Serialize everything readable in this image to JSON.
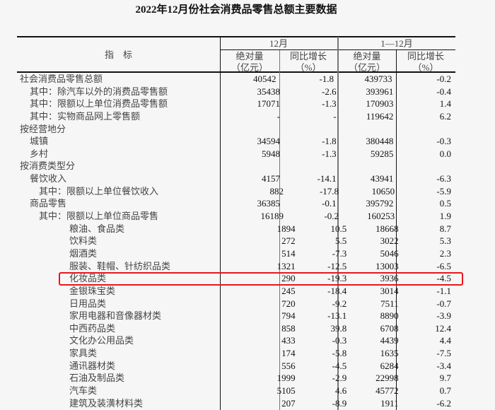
{
  "title": "2022年12月份社会消费品零售总额主要数据",
  "header": {
    "indicator": "指　标",
    "period1": "12月",
    "period2": "1—12月",
    "abs_label": "绝对量",
    "abs_unit": "（亿元）",
    "yoy_label": "同比增长",
    "yoy_unit": "（%）"
  },
  "rows": [
    {
      "label": "社会消费品零售总额",
      "level": 0,
      "m_abs": "40542",
      "m_yoy": "-1.8",
      "y_abs": "439733",
      "y_yoy": "-0.2"
    },
    {
      "label": "其中：除汽车以外的消费品零售额",
      "level": 1,
      "m_abs": "35438",
      "m_yoy": "-2.6",
      "y_abs": "393961",
      "y_yoy": "-0.4"
    },
    {
      "label": "其中：限额以上单位消费品零售额",
      "level": 1,
      "m_abs": "17071",
      "m_yoy": "-1.3",
      "y_abs": "170903",
      "y_yoy": "1.4"
    },
    {
      "label": "其中：实物商品网上零售额",
      "level": 1,
      "m_abs": "-",
      "m_yoy": "-",
      "y_abs": "119642",
      "y_yoy": "6.2"
    },
    {
      "label": "按经营地分",
      "level": 0,
      "m_abs": "",
      "m_yoy": "",
      "y_abs": "",
      "y_yoy": ""
    },
    {
      "label": "城镇",
      "level": 1,
      "m_abs": "34594",
      "m_yoy": "-1.8",
      "y_abs": "380448",
      "y_yoy": "-0.3"
    },
    {
      "label": "乡村",
      "level": 1,
      "m_abs": "5948",
      "m_yoy": "-1.3",
      "y_abs": "59285",
      "y_yoy": "0.0"
    },
    {
      "label": "按消费类型分",
      "level": 0,
      "m_abs": "",
      "m_yoy": "",
      "y_abs": "",
      "y_yoy": ""
    },
    {
      "label": "餐饮收入",
      "level": 1,
      "m_abs": "4157",
      "m_yoy": "-14.1",
      "y_abs": "43941",
      "y_yoy": "-6.3"
    },
    {
      "label": "其中：限额以上单位餐饮收入",
      "level": 2,
      "m_abs": "882",
      "m_yoy": "-17.8",
      "y_abs": "10650",
      "y_yoy": "-5.9"
    },
    {
      "label": "商品零售",
      "level": 1,
      "m_abs": "36385",
      "m_yoy": "-0.1",
      "y_abs": "395792",
      "y_yoy": "0.5"
    },
    {
      "label": "其中：限额以上单位商品零售",
      "level": 2,
      "m_abs": "16189",
      "m_yoy": "-0.2",
      "y_abs": "160253",
      "y_yoy": "1.9"
    },
    {
      "label": "粮油、食品类",
      "level": 3,
      "m_abs": "1894",
      "m_yoy": "10.5",
      "y_abs": "18668",
      "y_yoy": "8.7"
    },
    {
      "label": "饮料类",
      "level": 3,
      "m_abs": "272",
      "m_yoy": "5.5",
      "y_abs": "3022",
      "y_yoy": "5.3"
    },
    {
      "label": "烟酒类",
      "level": 3,
      "m_abs": "514",
      "m_yoy": "-7.3",
      "y_abs": "5046",
      "y_yoy": "2.3"
    },
    {
      "label": "服装、鞋帽、针纺织品类",
      "level": 3,
      "m_abs": "1321",
      "m_yoy": "-12.5",
      "y_abs": "13003",
      "y_yoy": "-6.5"
    },
    {
      "label": "化妆品类",
      "level": 3,
      "m_abs": "290",
      "m_yoy": "-19.3",
      "y_abs": "3936",
      "y_yoy": "-4.5"
    },
    {
      "label": "金银珠宝类",
      "level": 3,
      "m_abs": "245",
      "m_yoy": "-18.4",
      "y_abs": "3014",
      "y_yoy": "-1.1"
    },
    {
      "label": "日用品类",
      "level": 3,
      "m_abs": "720",
      "m_yoy": "-9.2",
      "y_abs": "7511",
      "y_yoy": "-0.7"
    },
    {
      "label": "家用电器和音像器材类",
      "level": 3,
      "m_abs": "794",
      "m_yoy": "-13.1",
      "y_abs": "8890",
      "y_yoy": "-3.9"
    },
    {
      "label": "中西药品类",
      "level": 3,
      "m_abs": "858",
      "m_yoy": "39.8",
      "y_abs": "6708",
      "y_yoy": "12.4"
    },
    {
      "label": "文化办公用品类",
      "level": 3,
      "m_abs": "433",
      "m_yoy": "-0.3",
      "y_abs": "4439",
      "y_yoy": "4.4"
    },
    {
      "label": "家具类",
      "level": 3,
      "m_abs": "174",
      "m_yoy": "-5.8",
      "y_abs": "1635",
      "y_yoy": "-7.5"
    },
    {
      "label": "通讯器材类",
      "level": 3,
      "m_abs": "556",
      "m_yoy": "-4.5",
      "y_abs": "6284",
      "y_yoy": "-3.4"
    },
    {
      "label": "石油及制品类",
      "level": 3,
      "m_abs": "1999",
      "m_yoy": "-2.9",
      "y_abs": "22998",
      "y_yoy": "9.7"
    },
    {
      "label": "汽车类",
      "level": 3,
      "m_abs": "5105",
      "m_yoy": "4.6",
      "y_abs": "45772",
      "y_yoy": "0.7"
    },
    {
      "label": "建筑及装潢材料类",
      "level": 3,
      "m_abs": "207",
      "m_yoy": "-8.9",
      "y_abs": "1911",
      "y_yoy": "-6.2"
    }
  ],
  "highlight_color": "#e8161b"
}
